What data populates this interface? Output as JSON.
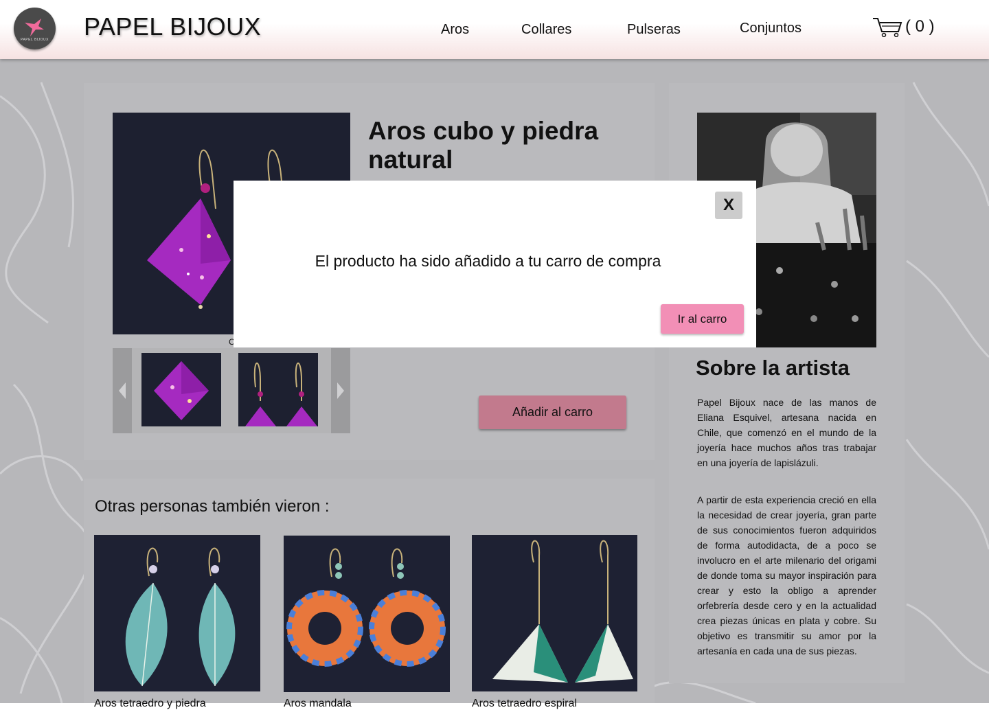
{
  "header": {
    "brand": "PAPEL BIJOUX",
    "logo_text": "PAPEL BIJOUX",
    "nav": [
      "Aros",
      "Collares",
      "Pulseras",
      "Conjuntos"
    ],
    "cart_count": "( 0 )"
  },
  "product": {
    "title": "Aros cubo y piedra natural",
    "add_to_cart_label": "Añadir al carro",
    "partial_caption": "C"
  },
  "also_viewed": {
    "title": "Otras personas también vieron :",
    "items": [
      {
        "name": "Aros tetraedro y piedra",
        "image": "leaf-earrings"
      },
      {
        "name": "Aros mandala",
        "image": "ring-earrings"
      },
      {
        "name": "Aros tetraedro espiral",
        "image": "pyramid-earrings"
      }
    ]
  },
  "artist": {
    "heading": "Sobre la artista",
    "paragraphs": [
      "Papel Bijoux nace de las manos de Eliana Esquivel, artesana nacida en Chile, que comenzó en el mundo de la joyería hace muchos años tras trabajar en una joyería de lapislázuli.",
      "A partir de esta experiencia creció en ella la necesidad de crear joyería, gran parte de sus conocimientos fueron adquiridos de forma autodidacta, de a poco se involucro en el arte milenario del origami de donde toma su mayor inspiración para crear y esto la obligo a aprender orfebrería desde cero y en la actualidad crea piezas únicas en plata y cobre. Su objetivo es transmitir su amor por la artesanía en cada una de sus piezas."
    ]
  },
  "modal": {
    "close_label": "X",
    "message": "El producto ha sido añadido a tu carro de compra",
    "cta_label": "Ir al carro"
  },
  "colors": {
    "header_bg_bottom": "#f6e2e2",
    "panel_bg": "#bababd",
    "add_button": "#c27a8d",
    "cta_button": "#f28fb6",
    "logo_bird": "#f06a9b"
  }
}
